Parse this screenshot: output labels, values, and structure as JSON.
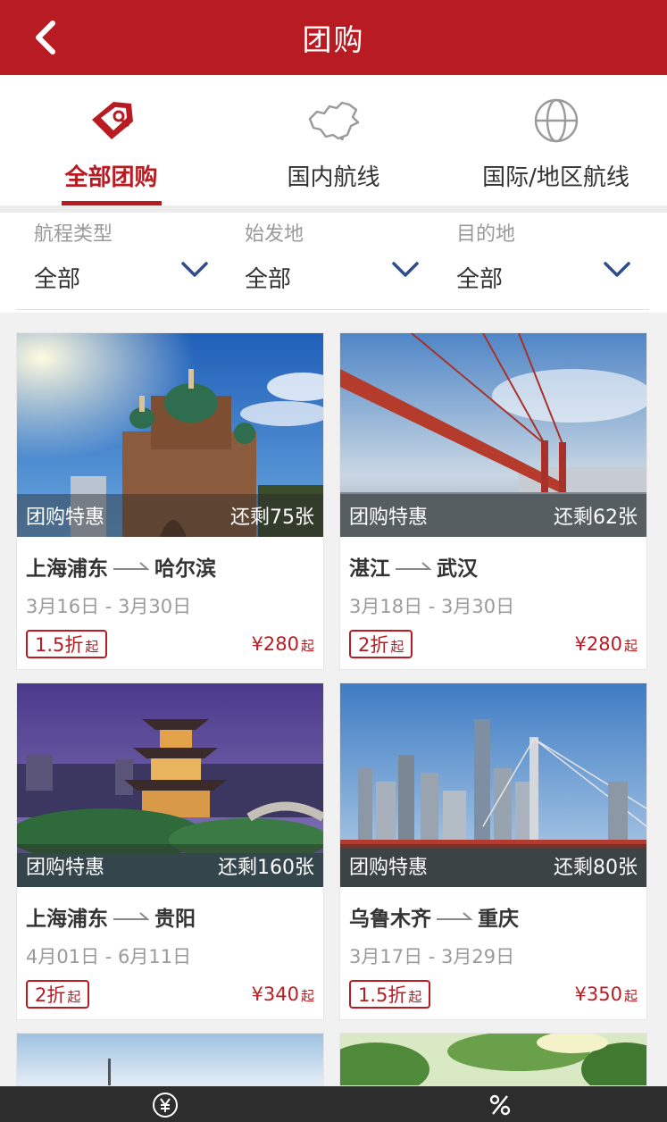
{
  "header": {
    "title": "团购",
    "back_icon": "chevron-left-icon"
  },
  "tabs": [
    {
      "label": "全部团购",
      "icon": "tag-icon",
      "active": true
    },
    {
      "label": "国内航线",
      "icon": "china-map-icon",
      "active": false
    },
    {
      "label": "国际/地区航线",
      "icon": "globe-icon",
      "active": false
    }
  ],
  "filters": [
    {
      "label": "航程类型",
      "value": "全部"
    },
    {
      "label": "始发地",
      "value": "全部"
    },
    {
      "label": "目的地",
      "value": "全部"
    }
  ],
  "cards": [
    {
      "tag": "团购特惠",
      "remaining": "还剩75张",
      "from": "上海浦东",
      "to": "哈尔滨",
      "dates": "3月16日 - 3月30日",
      "discount": "1.5折",
      "discount_suffix": "起",
      "price": "¥280",
      "price_suffix": "起"
    },
    {
      "tag": "团购特惠",
      "remaining": "还剩62张",
      "from": "湛江",
      "to": "武汉",
      "dates": "3月18日 - 3月30日",
      "discount": "2折",
      "discount_suffix": "起",
      "price": "¥280",
      "price_suffix": "起"
    },
    {
      "tag": "团购特惠",
      "remaining": "还剩160张",
      "from": "上海浦东",
      "to": "贵阳",
      "dates": "4月01日 - 6月11日",
      "discount": "2折",
      "discount_suffix": "起",
      "price": "¥340",
      "price_suffix": "起"
    },
    {
      "tag": "团购特惠",
      "remaining": "还剩80张",
      "from": "乌鲁木齐",
      "to": "重庆",
      "dates": "3月17日 - 3月29日",
      "discount": "1.5折",
      "discount_suffix": "起",
      "price": "¥350",
      "price_suffix": "起"
    }
  ],
  "bottom_bar": {
    "left_icon": "yuan-icon",
    "right_icon": "percent-icon"
  },
  "colors": {
    "brand": "#b81c22",
    "muted": "#9a9a9a",
    "text": "#333333"
  }
}
